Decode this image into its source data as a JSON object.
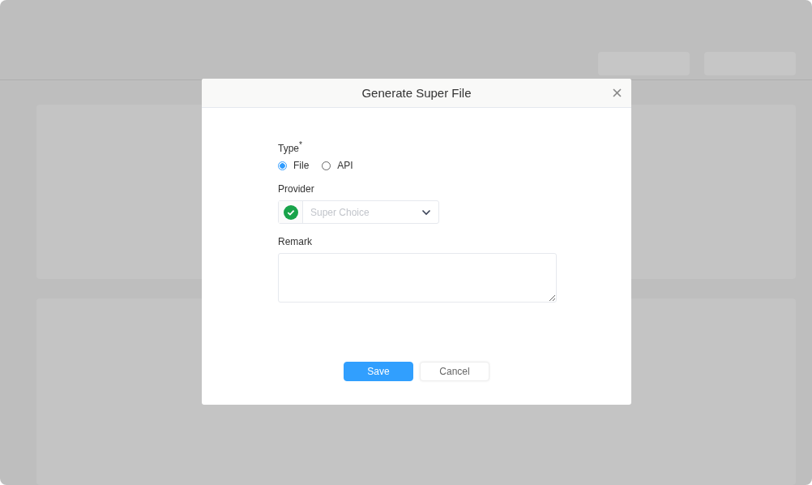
{
  "dialog": {
    "title": "Generate Super File"
  },
  "type_field": {
    "label": "Type$^{*}$",
    "options": [
      {
        "label": "File",
        "selected": true
      },
      {
        "label": "API",
        "selected": false
      }
    ]
  },
  "provider_field": {
    "label": "Provider",
    "placeholder": "Super Choice"
  },
  "remark_field": {
    "label": "Remark"
  },
  "buttons": [
    {
      "label": "Save",
      "kind": "primary"
    },
    {
      "label": "Cancel",
      "kind": "default"
    }
  ]
}
